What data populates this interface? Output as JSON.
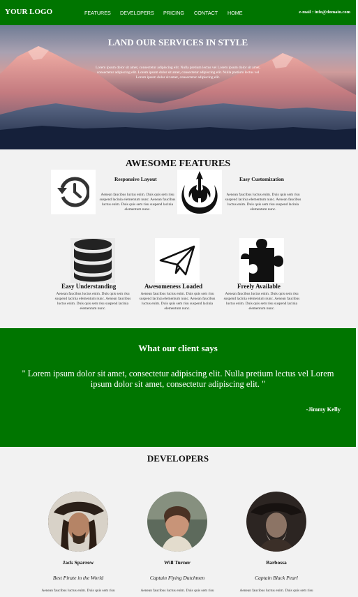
{
  "navbar": {
    "logo": "YOUR LOGO",
    "links": [
      "FEATURES",
      "DEVELOPERS",
      "PRICING",
      "CONTACT",
      "HOME"
    ],
    "email": "e-mail : info@domain.com"
  },
  "hero": {
    "title": "LAND OUR SERVICES IN STYLE",
    "text": "Lorem ipsum dolor sit amet, consectetur adipiscing elit. Nulla pretium lectus vel Lorem ipsum dolor sit amet, consectetur adipiscing elit. Lorem ipsum dolor sit amet, consectetur adipiscing elit. Nulla pretium lectus vel Lorem ipsum dolor sit amet, consectetur adipiscing elit."
  },
  "features": {
    "title": "AWESOME FEATURES",
    "items": [
      {
        "name": "Responsive Layout",
        "icon": "history-icon",
        "text": "Aenean faucibus luctus enim. Duis quis sem risu suspend lacinia elementum nunc. Aenean faucibus luctus enim. Duis quis sem risu suspend lacinia elementum nunc."
      },
      {
        "name": "",
        "icon": "rebel-alliance-icon",
        "text": ""
      },
      {
        "name": "Easy Customization",
        "icon": "",
        "text": "Aenean faucibus luctus enim. Duis quis sem risu suspend lacinia elementum nunc. Aenean faucibus luctus enim. Duis quis sem risu suspend lacinia elementum nunc."
      },
      {
        "name": "Easy Understanding",
        "icon": "database-icon",
        "text": "Aenean faucibus luctus enim. Duis quis sem risu suspend lacinia elementum nunc. Aenean faucibus luctus enim. Duis quis sem risu suspend lacinia elementum nunc."
      },
      {
        "name": "Awesomeness Loaded",
        "icon": "paper-plane-icon",
        "text": "Aenean faucibus luctus enim. Duis quis sem risu suspend lacinia elementum nunc. Aenean faucibus luctus enim. Duis quis sem risu suspend lacinia elementum nunc."
      },
      {
        "name": "Freely Available",
        "icon": "puzzle-piece-icon",
        "text": "Aenean faucibus luctus enim. Duis quis sem risu suspend lacinia elementum nunc. Aenean faucibus luctus enim. Duis quis sem risu suspend lacinia elementum nunc."
      }
    ]
  },
  "testimonial": {
    "title": "What our client says",
    "quote": "\" Lorem ipsum dolor sit amet, consectetur adipiscing elit. Nulla pretium lectus vel Lorem ipsum dolor sit amet, consectetur adipiscing elit. \"",
    "author": "-Jimmy Kelly"
  },
  "developers": {
    "title": "DEVELOPERS",
    "items": [
      {
        "name": "Jack Sparrow",
        "role": "Best Pirate in the World",
        "text": "Aenean faucibus luctus enim. Duis quis sem risu"
      },
      {
        "name": "Will Turner",
        "role": "Captain Flying Dutchmen",
        "text": "Aenean faucibus luctus enim. Duis quis sem risu"
      },
      {
        "name": "Barbossa",
        "role": "Captain Black Pearl",
        "text": "Aenean faucibus luctus enim. Duis quis sem risu"
      }
    ]
  },
  "colors": {
    "brand_green": "#007500",
    "background": "#f2f2f2"
  }
}
